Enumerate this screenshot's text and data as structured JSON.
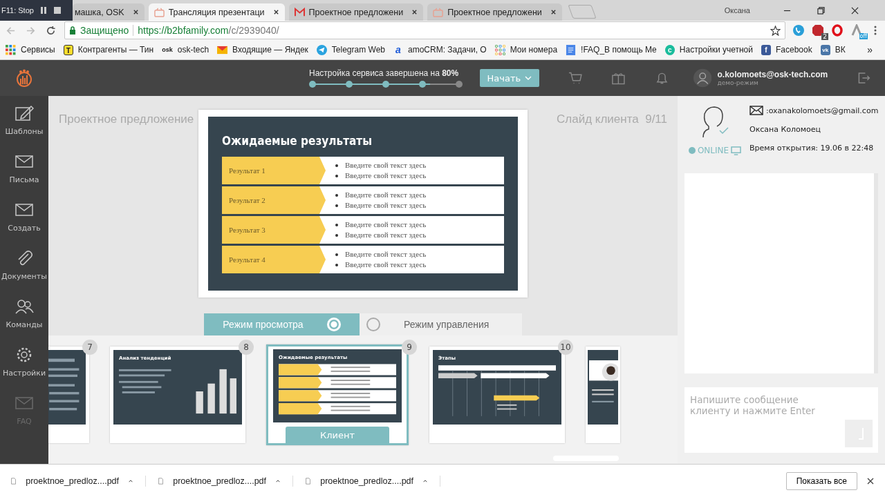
{
  "browser": {
    "recorder": {
      "label": "F11: Stop"
    },
    "tabs": [
      {
        "label": "машка, OSK",
        "selected": false,
        "kind": "plain"
      },
      {
        "label": "Трансляция презентаци",
        "selected": true,
        "kind": "app"
      },
      {
        "label": "Проектное предложени",
        "selected": false,
        "kind": "mail"
      },
      {
        "label": "Проектное предложени",
        "selected": false,
        "kind": "app"
      }
    ],
    "profile_name": "Оксана",
    "address": {
      "secure_label": "Защищено",
      "url_host": "https://b2bfamily.com",
      "url_path": "/c/2939040/"
    },
    "extension_badge": "2",
    "extension_off": "off",
    "bookmarks": [
      {
        "label": "Сервисы",
        "kind": "grid"
      },
      {
        "label": "Контрагенты — Тин",
        "kind": "t",
        "badge": "T"
      },
      {
        "label": "osk-tech",
        "kind": "osk",
        "badge": "osk"
      },
      {
        "label": "Входящие — Яндек",
        "kind": "mail"
      },
      {
        "label": "Telegram Web",
        "kind": "plane"
      },
      {
        "label": "amoCRM: Задачи, О",
        "kind": "amo",
        "badge": "a"
      },
      {
        "label": "Мои номера",
        "kind": "dots"
      },
      {
        "label": "!FAQ_В помощь Ме",
        "kind": "doc"
      },
      {
        "label": "Настройки учетной",
        "kind": "c",
        "badge": "c"
      },
      {
        "label": "Facebook",
        "kind": "fb",
        "badge": "f"
      },
      {
        "label": "ВК",
        "kind": "vk",
        "badge": "vk"
      }
    ],
    "bookmarks_more": "»"
  },
  "header": {
    "progress": {
      "label": "Настройка сервиса завершена на **80%**",
      "level": 0.8
    },
    "start_button": "Начать",
    "user": {
      "email": "o.kolomoets@osk-tech.com",
      "mode": "демо-режим"
    }
  },
  "sidebar": [
    {
      "label": "Шаблоны",
      "kind": "edit",
      "disabled": false
    },
    {
      "label": "Письма",
      "kind": "mail",
      "disabled": false
    },
    {
      "label": "Создать",
      "kind": "mail",
      "disabled": false
    },
    {
      "label": "Документы",
      "kind": "clip",
      "disabled": false
    },
    {
      "label": "Команды",
      "kind": "team",
      "disabled": false
    },
    {
      "label": "Настройки",
      "kind": "gear",
      "disabled": false
    },
    {
      "label": "FAQ",
      "kind": "mail",
      "disabled": true
    }
  ],
  "presentation": {
    "title": "Проектное предложение",
    "counter": "Слайд клиента  9/11",
    "slide": {
      "title": "Ожидаемые результаты",
      "rows": [
        {
          "label": "Результат 1",
          "bullets": [
            "Введите свой текст здесь",
            "Введите свой текст здесь"
          ]
        },
        {
          "label": "Результат 2",
          "bullets": [
            "Введите свой текст здесь",
            "Введите свой текст здесь"
          ]
        },
        {
          "label": "Результат 3",
          "bullets": [
            "Введите свой текст здесь",
            "Введите свой текст здесь"
          ]
        },
        {
          "label": "Результат 4",
          "bullets": [
            "Введите свой текст здесь",
            "Введите свой текст здесь"
          ]
        }
      ]
    },
    "modes": [
      {
        "label": "Режим просмотра",
        "selected": true
      },
      {
        "label": "Режим управления",
        "selected": false
      }
    ],
    "thumbnails": [
      {
        "number": "7",
        "kind": "text",
        "selected": false
      },
      {
        "number": "8",
        "kind": "chart",
        "title": "Анализ тенденций",
        "selected": false
      },
      {
        "number": "9",
        "kind": "results",
        "title": "Ожидаемые результаты",
        "selected": true,
        "tag": "Клиент"
      },
      {
        "number": "10",
        "kind": "timeline",
        "title": "Этапы",
        "selected": false
      },
      {
        "kind": "profile",
        "selected": false
      }
    ]
  },
  "client": {
    "email": ":oxanakolomoets@gmail.com",
    "name": "Оксана Коломоец",
    "status": "ONLINE",
    "opened": "Время открытия: 19.06 в 22:48",
    "message_placeholder": "Напишите сообщение клиенту и нажмите Enter"
  },
  "downloads": {
    "files": [
      "proektnoe_predloz....pdf",
      "proektnoe_predloz....pdf",
      "proektnoe_predloz....pdf"
    ],
    "show_all": "Показать все"
  }
}
